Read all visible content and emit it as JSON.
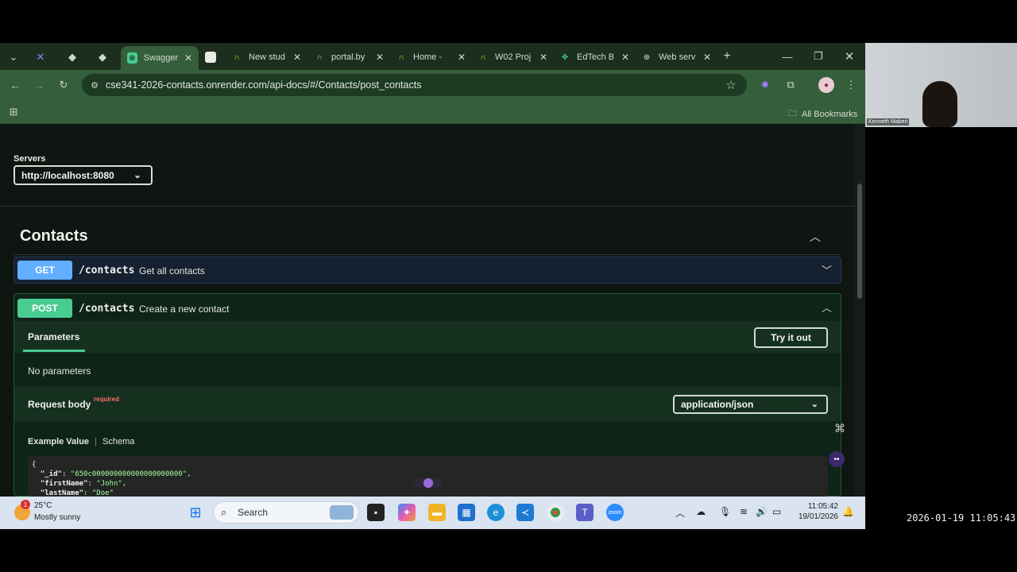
{
  "browser": {
    "tabs": [
      {
        "title": "Swagger",
        "active": true
      },
      {
        "title": "",
        "active": false
      },
      {
        "title": "New stud",
        "active": false
      },
      {
        "title": "portal.by",
        "active": false
      },
      {
        "title": "Home -",
        "active": false
      },
      {
        "title": "W02 Proj",
        "active": false
      },
      {
        "title": "EdTech B",
        "active": false
      },
      {
        "title": "Web serv",
        "active": false
      }
    ],
    "url": "cse341-2026-contacts.onrender.com/api-docs/#/Contacts/post_contacts",
    "bookmarks_label": "All Bookmarks",
    "accent": "#355e3b"
  },
  "swagger": {
    "servers_label": "Servers",
    "server_value": "http://localhost:8080",
    "section_title": "Contacts",
    "operations": [
      {
        "method": "GET",
        "path": "/contacts",
        "summary": "Get all contacts",
        "color": "#61affe"
      },
      {
        "method": "POST",
        "path": "/contacts",
        "summary": "Create a new contact",
        "color": "#49cc90"
      }
    ],
    "parameters_tab": "Parameters",
    "try_it_out": "Try it out",
    "no_parameters": "No parameters",
    "request_body_label": "Request body",
    "required_label": "required",
    "content_type": "application/json",
    "example_value_tab": "Example Value",
    "schema_tab": "Schema",
    "code_lines": [
      {
        "key": "",
        "value": "{"
      },
      {
        "key": "\"_id\"",
        "value": "\"650c000000000000000000000\","
      },
      {
        "key": "\"firstName\"",
        "value": "\"John\","
      },
      {
        "key": "\"lastName\"",
        "value": "\"Doe\""
      }
    ]
  },
  "taskbar": {
    "weather_badge": "1",
    "temperature": "25°C",
    "condition": "Mostly sunny",
    "search_placeholder": "Search",
    "time": "11:05:42",
    "date": "19/01/2026"
  },
  "webcam": {
    "name": "Kenneth Maberi"
  },
  "recording_timestamp": "2026-01-19 11:05:43"
}
